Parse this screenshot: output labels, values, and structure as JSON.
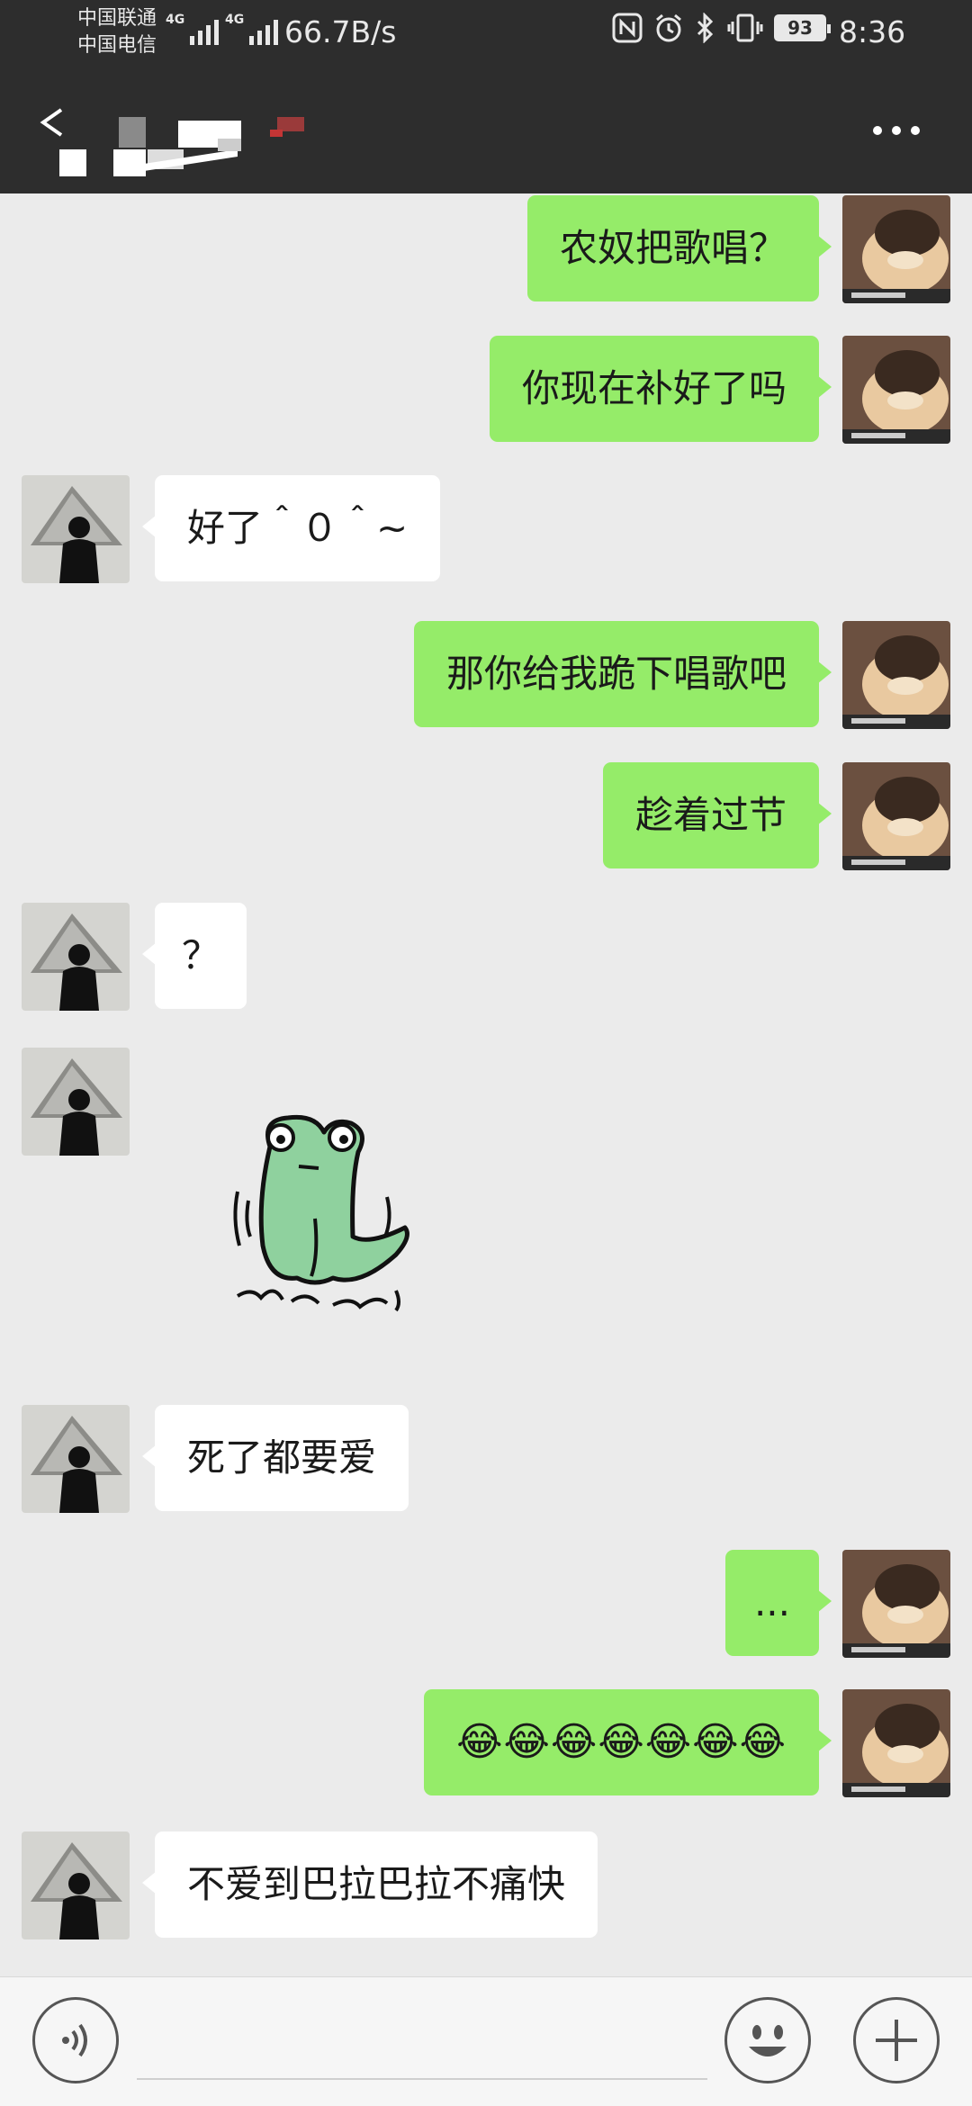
{
  "status_bar": {
    "carrier_1": "中国联通",
    "carrier_2": "中国电信",
    "net_type_1": "4G",
    "net_type_2": "4G",
    "speed": "66.7B/s",
    "battery": "93",
    "time": "8:36",
    "icons": [
      "nfc-icon",
      "alarm-icon",
      "bluetooth-icon",
      "vibrate-icon"
    ]
  },
  "header": {
    "back_icon": "chevron-left-icon",
    "title_obscured": true,
    "more_icon": "ellipsis-icon"
  },
  "messages": [
    {
      "side": "right",
      "type": "text",
      "text": "农奴把歌唱？"
    },
    {
      "side": "right",
      "type": "text",
      "text": "你现在补好了吗"
    },
    {
      "side": "left",
      "type": "text",
      "text": "好了＾０＾~"
    },
    {
      "side": "right",
      "type": "text",
      "text": "那你给我跪下唱歌吧"
    },
    {
      "side": "right",
      "type": "text",
      "text": "趁着过节"
    },
    {
      "side": "left",
      "type": "text",
      "text": "？"
    },
    {
      "side": "left",
      "type": "sticker",
      "sticker": "green-frog-sticker"
    },
    {
      "side": "left",
      "type": "text",
      "text": "死了都要爱"
    },
    {
      "side": "right",
      "type": "text",
      "text": "..."
    },
    {
      "side": "right",
      "type": "text",
      "text": "😂😂😂😂😂😂😂"
    },
    {
      "side": "left",
      "type": "text",
      "text": "不爱到巴拉巴拉不痛快"
    }
  ],
  "input_bar": {
    "voice_icon": "voice-icon",
    "emoji_icon": "smiley-icon",
    "plus_icon": "plus-icon",
    "input_value": ""
  },
  "colors": {
    "header_bg": "#2d2d2d",
    "chat_bg": "#ebebeb",
    "sent_bubble": "#95ec69",
    "received_bubble": "#ffffff"
  }
}
